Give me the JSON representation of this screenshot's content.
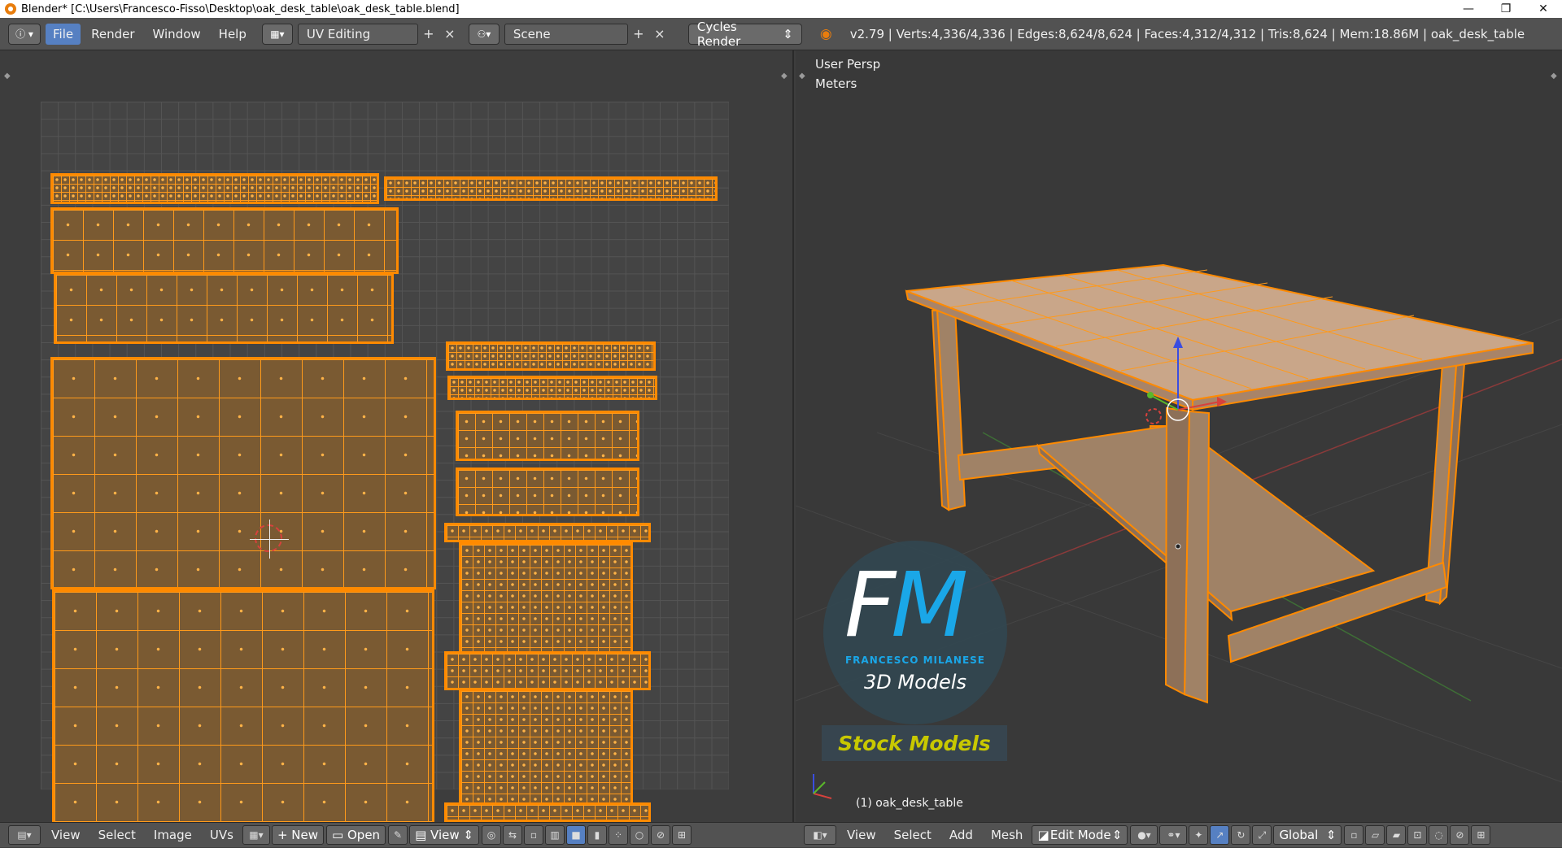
{
  "window": {
    "title": "Blender* [C:\\Users\\Francesco-Fisso\\Desktop\\oak_desk_table\\oak_desk_table.blend]",
    "minimize": "—",
    "maximize": "❐",
    "close": "✕"
  },
  "topbar": {
    "info_icon": "ⓘ",
    "menus": [
      "File",
      "Render",
      "Window",
      "Help"
    ],
    "screen_layout": "UV Editing",
    "scene": "Scene",
    "render_engine": "Cycles Render",
    "stats": "v2.79 | Verts:4,336/4,336 | Edges:8,624/8,624 | Faces:4,312/4,312 | Tris:8,624 | Mem:18.86M | oak_desk_table"
  },
  "viewport": {
    "view_name": "User Persp",
    "units": "Meters",
    "object_label": "(1) oak_desk_table"
  },
  "watermark": {
    "logo_f": "F",
    "logo_m": "M",
    "name": "FRANCESCO MILANESE",
    "tagline": "3D Models",
    "stock": "Stock Models"
  },
  "uv_editor_bar": {
    "menus": [
      "View",
      "Select",
      "Image",
      "UVs"
    ],
    "new_label": "New",
    "open_label": "Open",
    "view_label": "View"
  },
  "view3d_bar": {
    "menus": [
      "View",
      "Select",
      "Add",
      "Mesh"
    ],
    "mode": "Edit Mode",
    "orientation": "Global"
  },
  "colors": {
    "accent": "#5680c2",
    "selection": "#ff8a00",
    "x_axis": "#d8413c",
    "y_axis": "#5ab82a",
    "z_axis": "#3a4de0"
  }
}
